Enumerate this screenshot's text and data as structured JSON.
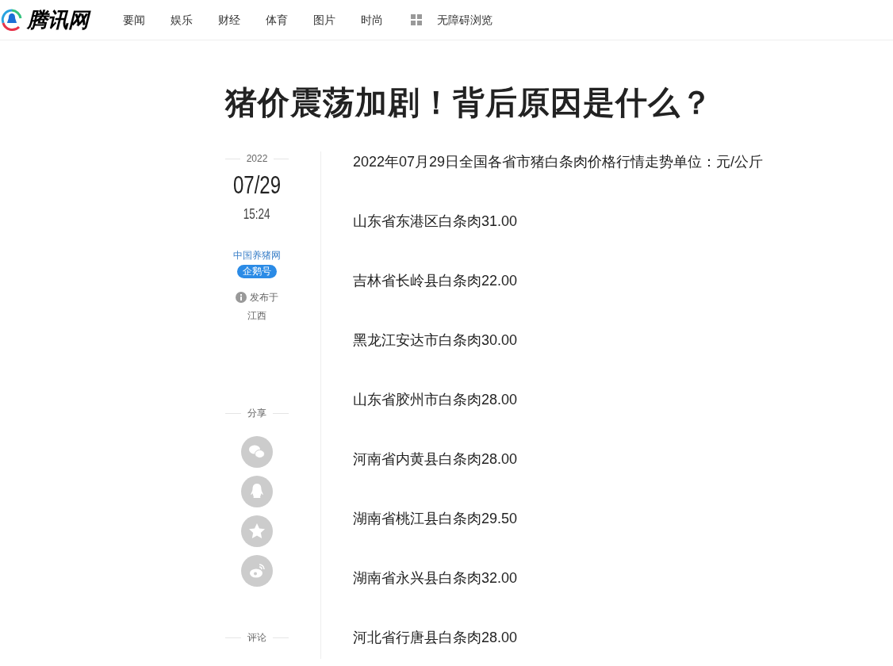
{
  "header": {
    "logo": "腾讯网",
    "nav": [
      "要闻",
      "娱乐",
      "财经",
      "体育",
      "图片",
      "时尚"
    ],
    "accessibility": "无障碍浏览"
  },
  "article": {
    "title": "猪价震荡加剧！背后原因是什么？",
    "meta": {
      "year": "2022",
      "date": "07/29",
      "time": "15:24",
      "source": "中国养猪网",
      "badge": "企鹅号",
      "published_label": "发布于",
      "location": "江西",
      "share_label": "分享",
      "comment_label": "评论"
    },
    "paragraphs": [
      "2022年07月29日全国各省市猪白条肉价格行情走势单位：元/公斤",
      "山东省东港区白条肉31.00",
      "吉林省长岭县白条肉22.00",
      "黑龙江安达市白条肉30.00",
      "山东省胶州市白条肉28.00",
      "河南省内黄县白条肉28.00",
      "湖南省桃江县白条肉29.50",
      "湖南省永兴县白条肉32.00",
      "河北省行唐县白条肉28.00"
    ]
  }
}
